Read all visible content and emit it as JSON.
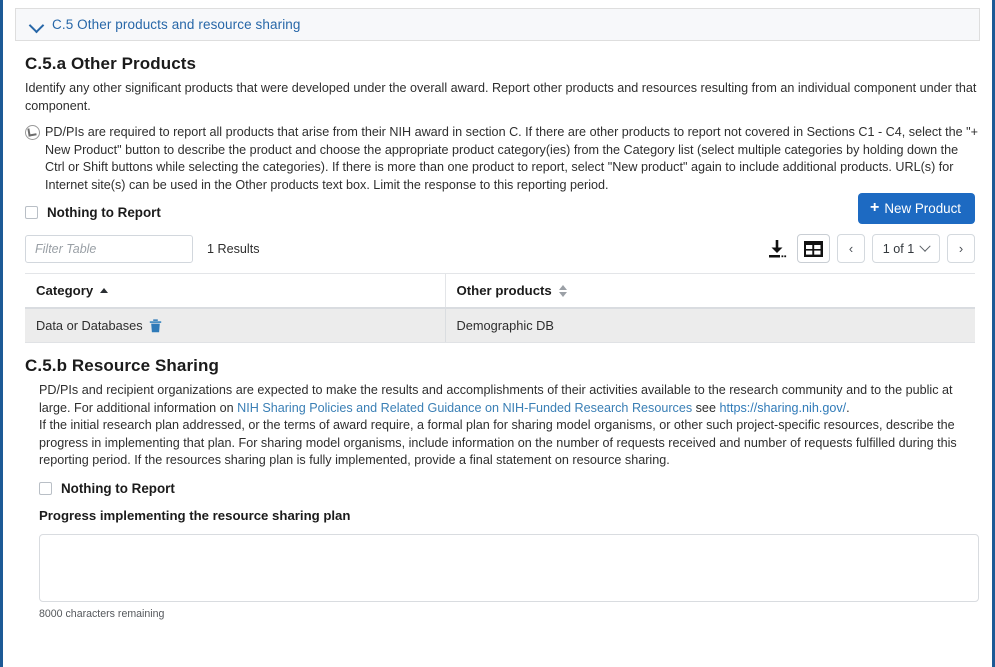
{
  "accordion": {
    "title": "C.5 Other products and resource sharing",
    "chevron_icon": "chevron-down-icon",
    "expanded": true
  },
  "section_a": {
    "heading": "C.5.a Other Products",
    "paragraph": "Identify any other significant products that were developed under the overall award. Report other products and resources resulting from an individual component under that component.",
    "hint_icon": "pencil-circle-icon",
    "hint": "PD/PIs are required to report all products that arise from their NIH award in section C. If there are other products to report not covered in Sections C1 - C4, select the \"+ New Product\" button to describe the product and choose the appropriate product category(ies) from the Category list (select multiple categories by holding down the Ctrl or Shift buttons while selecting the categories). If there is more than one product to report, select \"New product\" again to include additional products. URL(s) for Internet site(s) can be used in the Other products text box. Limit the response to this reporting period.",
    "nothing_to_report_label": "Nothing to Report",
    "nothing_to_report_checked": false,
    "new_product_button": "New Product",
    "new_product_icon": "plus-icon",
    "new_product_color": "#1d6ac2"
  },
  "toolbar": {
    "filter_placeholder": "Filter Table",
    "filter_value": "",
    "results_text": "1 Results",
    "download_icon": "download-icon",
    "grid_view_icon": "table-grid-icon",
    "prev_icon": "chevron-left-icon",
    "next_icon": "chevron-right-icon",
    "page_indicator": "1 of 1",
    "page_caret_icon": "chevron-down-icon"
  },
  "table": {
    "columns": [
      {
        "label": "Category",
        "sort": "asc",
        "sort_icon": "sort-ascending-icon"
      },
      {
        "label": "Other products",
        "sort": "none",
        "sort_icon": "sort-both-icon"
      }
    ],
    "rows": [
      {
        "category": "Data or Databases",
        "delete_icon": "trash-icon",
        "delete_icon_color": "#2f7ab8",
        "other_products": "Demographic DB"
      }
    ]
  },
  "section_b": {
    "heading": "C.5.b Resource Sharing",
    "paragraph_1_pre": "PD/PIs and recipient organizations are expected to make the results and accomplishments of their activities available to the research community and to the public at large. For additional information on ",
    "paragraph_1_em": "NIH Sharing Policies and Related Guidance on NIH-Funded Research Resources",
    "paragraph_1_mid": " see ",
    "link_text": "https://sharing.nih.gov/",
    "paragraph_1_post": ".",
    "paragraph_2": "If the initial research plan addressed, or the terms of award require, a formal plan for sharing model organisms, or other such project-specific resources, describe the progress in implementing that plan. For sharing model organisms, include information on the number of requests received and number of requests fulfilled during this reporting period. If the resources sharing plan is fully implemented, provide a final statement on resource sharing.",
    "nothing_to_report_label": "Nothing to Report",
    "nothing_to_report_checked": false,
    "progress_label": "Progress implementing the resource sharing plan",
    "progress_value": "",
    "chars_remaining": "8000 characters remaining"
  }
}
